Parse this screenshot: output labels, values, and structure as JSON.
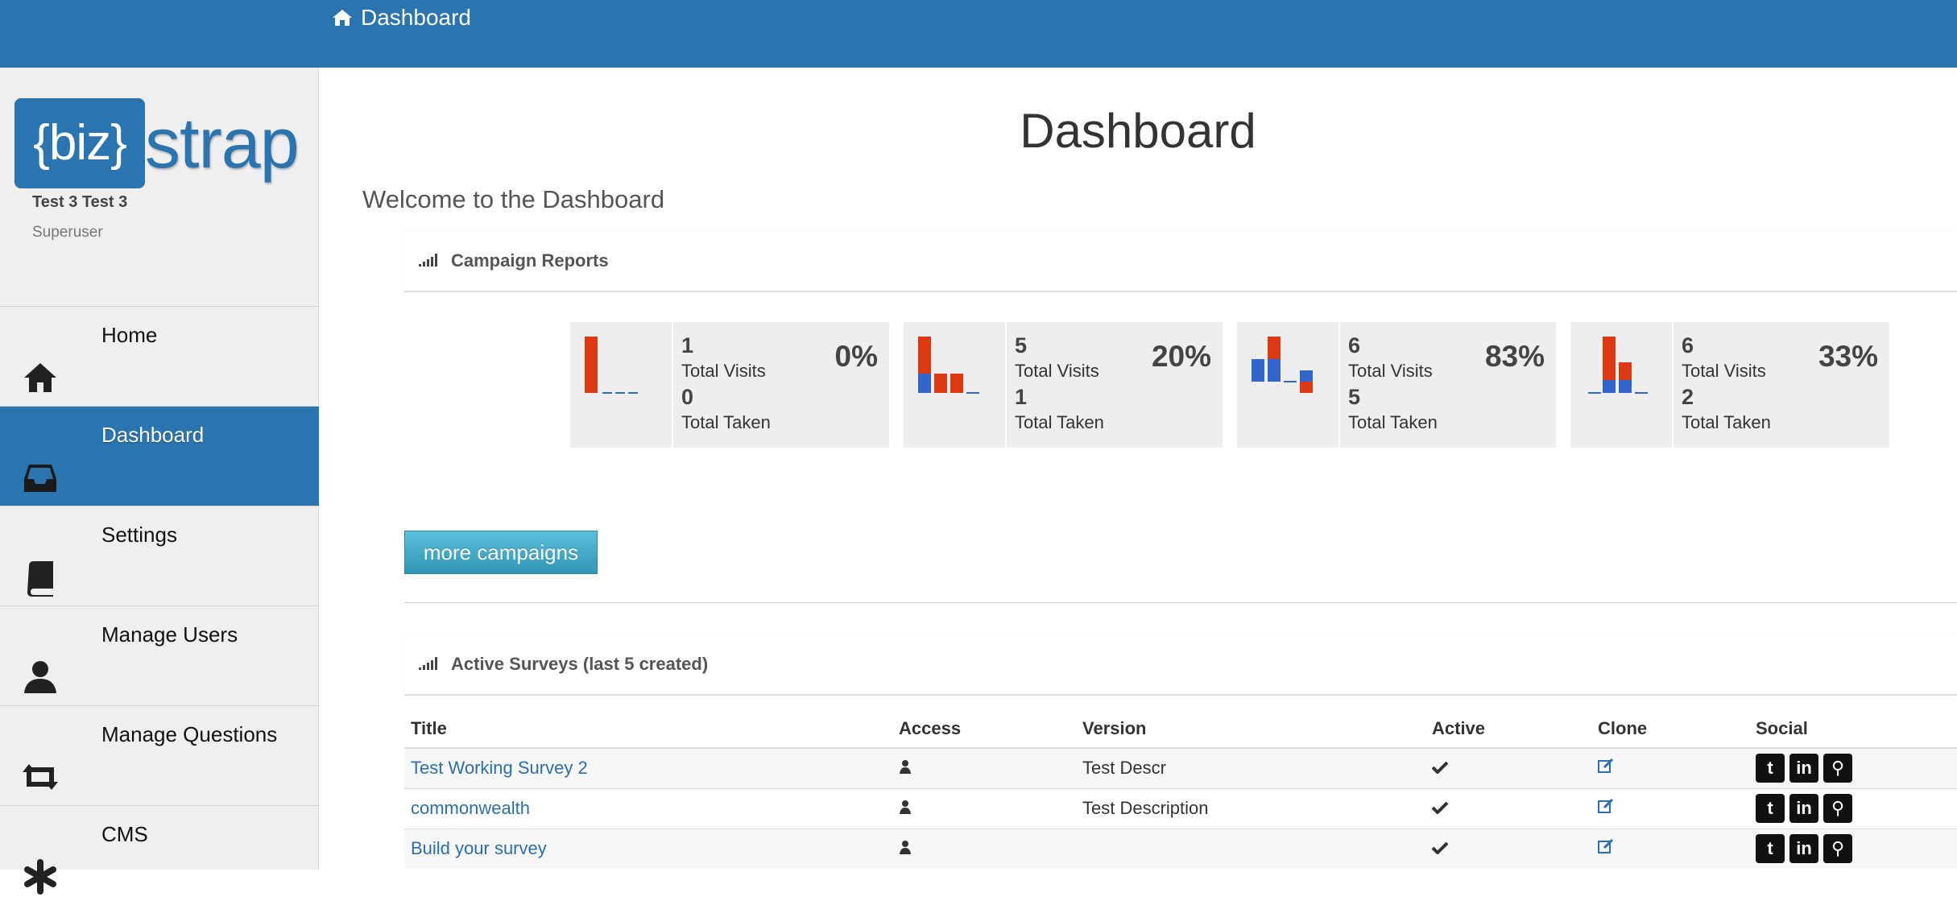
{
  "topbar": {
    "crumb": "Dashboard",
    "crumb_icon": "home-icon",
    "color": "#2a74b0"
  },
  "sidebar": {
    "logo": {
      "box_text": "{biz}",
      "rest_text": "strap"
    },
    "user_name": "Test 3 Test 3",
    "user_role": "Superuser",
    "items": [
      {
        "label": "Home",
        "icon": "home-icon"
      },
      {
        "label": "Dashboard",
        "icon": "inbox-icon",
        "active": true
      },
      {
        "label": "Settings",
        "icon": "book-icon"
      },
      {
        "label": "Manage Users",
        "icon": "user-icon"
      },
      {
        "label": "Manage Questions",
        "icon": "retweet-icon"
      },
      {
        "label": "CMS",
        "icon": "asterisk-icon"
      }
    ]
  },
  "main": {
    "title": "Dashboard",
    "welcome": "Welcome to the Dashboard",
    "campaign_reports": {
      "title": "Campaign Reports",
      "stats": [
        {
          "visits": "1",
          "visits_label": "Total Visits",
          "taken": "0",
          "taken_label": "Total Taken",
          "percent": "0%"
        },
        {
          "visits": "5",
          "visits_label": "Total Visits",
          "taken": "1",
          "taken_label": "Total Taken",
          "percent": "20%"
        },
        {
          "visits": "6",
          "visits_label": "Total Visits",
          "taken": "5",
          "taken_label": "Total Taken",
          "percent": "83%"
        },
        {
          "visits": "6",
          "visits_label": "Total Visits",
          "taken": "2",
          "taken_label": "Total Taken",
          "percent": "33%"
        }
      ],
      "more_button": "more campaigns"
    },
    "active_surveys": {
      "title": "Active Surveys (last 5 created)",
      "columns": [
        "Title",
        "Access",
        "Version",
        "Active",
        "Clone",
        "Social"
      ],
      "rows": [
        {
          "title": "Test Working Survey 2",
          "version": "Test Descr"
        },
        {
          "title": "commonwealth",
          "version": "Test Description"
        },
        {
          "title": "Build your survey",
          "version": ""
        }
      ]
    }
  }
}
